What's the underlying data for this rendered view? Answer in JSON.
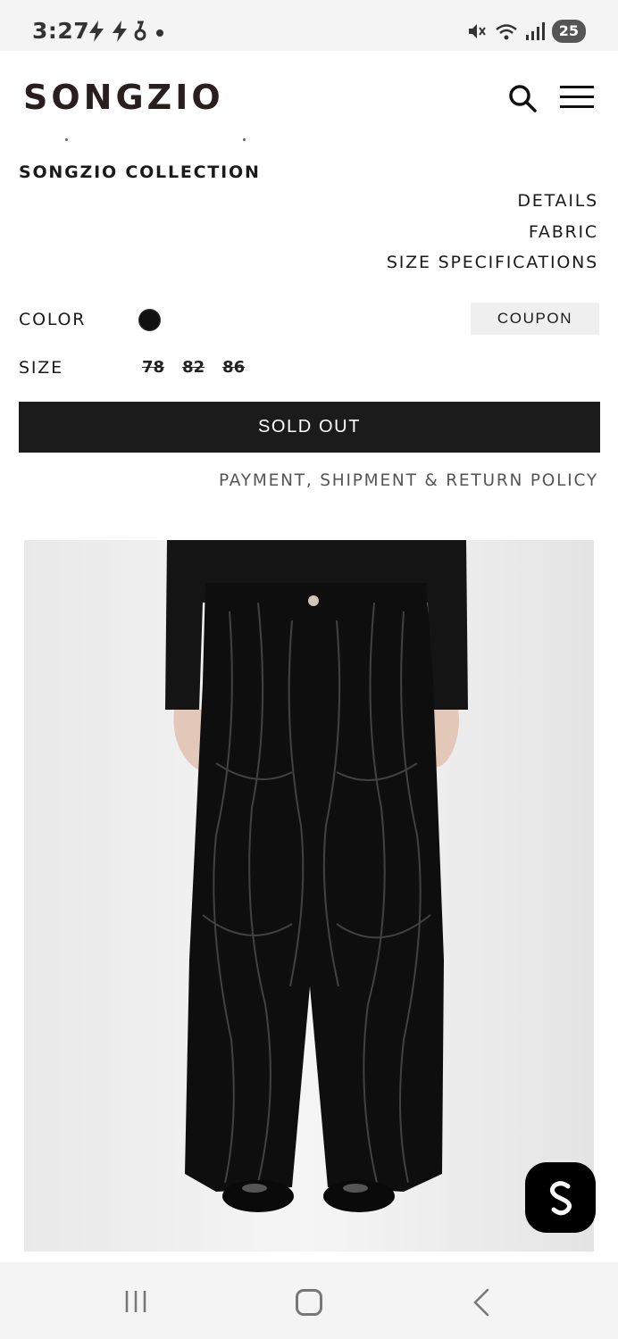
{
  "status_bar": {
    "time": "3:27",
    "left_icons": [
      "flash-icon",
      "flash-icon",
      "notification-icon",
      "dot-icon"
    ],
    "right_icons": [
      "mute-icon",
      "wifi-icon",
      "signal-icon"
    ],
    "battery": "25"
  },
  "header": {
    "brand": "SONGZIO",
    "search_icon": "search-icon",
    "menu_icon": "hamburger-menu-icon"
  },
  "product": {
    "collection": "SONGZIO COLLECTION",
    "info_links": [
      "DETAILS",
      "FABRIC",
      "SIZE SPECIFICATIONS"
    ],
    "color_label": "COLOR",
    "color_value": "#111111",
    "size_label": "SIZE",
    "sizes": [
      "78",
      "82",
      "86"
    ],
    "coupon_label": "COUPON",
    "buy_label": "SOLD OUT",
    "policy_label": "PAYMENT, SHIPMENT & RETURN POLICY"
  },
  "colors": {
    "brand": "#2a1f1f",
    "button_dark": "#1c1b1b",
    "coupon_bg": "#efefef"
  },
  "nav_bar": {
    "icons": [
      "recent-apps-icon",
      "home-icon",
      "back-icon"
    ]
  }
}
